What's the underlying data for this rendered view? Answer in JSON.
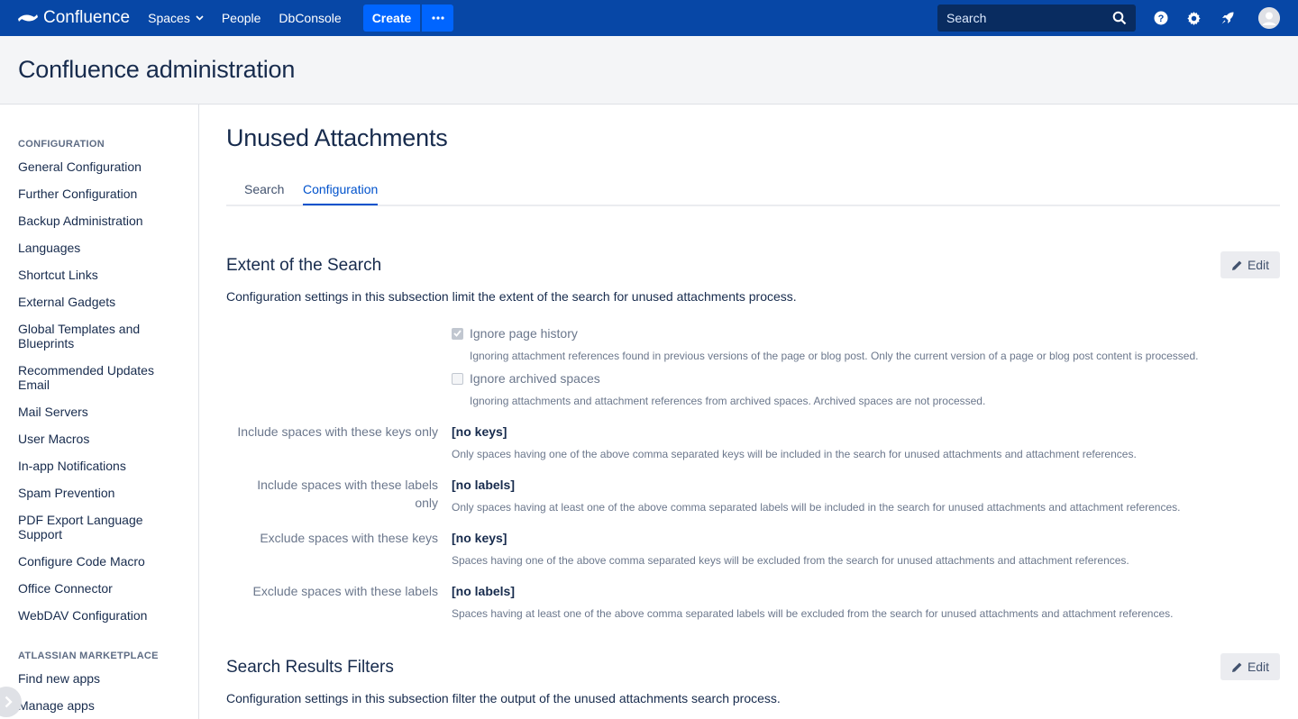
{
  "topnav": {
    "brand": "Confluence",
    "links": [
      "Spaces",
      "People",
      "DbConsole"
    ],
    "create_label": "Create",
    "search_placeholder": "Search"
  },
  "header": {
    "title": "Confluence administration"
  },
  "sidebar": {
    "config_heading": "CONFIGURATION",
    "config_items": [
      "General Configuration",
      "Further Configuration",
      "Backup Administration",
      "Languages",
      "Shortcut Links",
      "External Gadgets",
      "Global Templates and Blueprints",
      "Recommended Updates Email",
      "Mail Servers",
      "User Macros",
      "In-app Notifications",
      "Spam Prevention",
      "PDF Export Language Support",
      "Configure Code Macro",
      "Office Connector",
      "WebDAV Configuration"
    ],
    "marketplace_heading": "ATLASSIAN MARKETPLACE",
    "marketplace_items": [
      "Find new apps",
      "Manage apps"
    ]
  },
  "main": {
    "title": "Unused Attachments",
    "tabs": [
      "Search",
      "Configuration"
    ],
    "active_tab": "Configuration",
    "sections": [
      {
        "title": "Extent of the Search",
        "edit_label": "Edit",
        "description": "Configuration settings in this subsection limit the extent of the search for unused attachments process.",
        "checkboxes": [
          {
            "label": "Ignore page history",
            "checked": true,
            "hint": "Ignoring attachment references found in previous versions of the page or blog post. Only the current version of a page or blog post content is processed."
          },
          {
            "label": "Ignore archived spaces",
            "checked": false,
            "hint": "Ignoring attachments and attachment references from archived spaces. Archived spaces are not processed."
          }
        ],
        "fields": [
          {
            "label": "Include spaces with these keys only",
            "value": "[no keys]",
            "hint": "Only spaces having one of the above comma separated keys will be included in the search for unused attachments and attachment references."
          },
          {
            "label": "Include spaces with these labels only",
            "value": "[no labels]",
            "hint": "Only spaces having at least one of the above comma separated labels will be included in the search for unused attachments and attachment references."
          },
          {
            "label": "Exclude spaces with these keys",
            "value": "[no keys]",
            "hint": "Spaces having one of the above comma separated keys will be excluded from the search for unused attachments and attachment references."
          },
          {
            "label": "Exclude spaces with these labels",
            "value": "[no labels]",
            "hint": "Spaces having at least one of the above comma separated labels will be excluded from the search for unused attachments and attachment references."
          }
        ]
      },
      {
        "title": "Search Results Filters",
        "edit_label": "Edit",
        "description": "Configuration settings in this subsection filter the output of the unused attachments search process."
      }
    ]
  },
  "colors": {
    "nav_bg": "#0747A6",
    "create_bg": "#0065FF",
    "accent": "#0052CC",
    "text": "#172B4D",
    "muted": "#6B778C"
  }
}
